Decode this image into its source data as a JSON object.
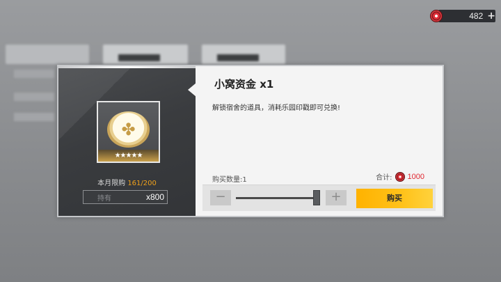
{
  "currency": {
    "icon": "gem-coin-icon",
    "amount": "482",
    "plus_label": "+"
  },
  "item": {
    "name": "小窝资金 x1",
    "description": "解锁宿舍的道具，消耗乐园印戳即可兑换!",
    "stars": "★★★★★",
    "icon": "clover-coin-icon"
  },
  "limit": {
    "label": "本月限购",
    "count": "161/200"
  },
  "owned": {
    "label": "持有",
    "value": "x800"
  },
  "purchase": {
    "qty_label": "购买数量:1",
    "total_label": "合计:",
    "total_price": "1000",
    "minus_label": "−",
    "plus_label": "+",
    "buy_label": "购买",
    "slider_fraction": 1.0
  },
  "colors": {
    "accent": "#ffb200",
    "price_red": "#e0252e",
    "limit_orange": "#f0a11b"
  }
}
